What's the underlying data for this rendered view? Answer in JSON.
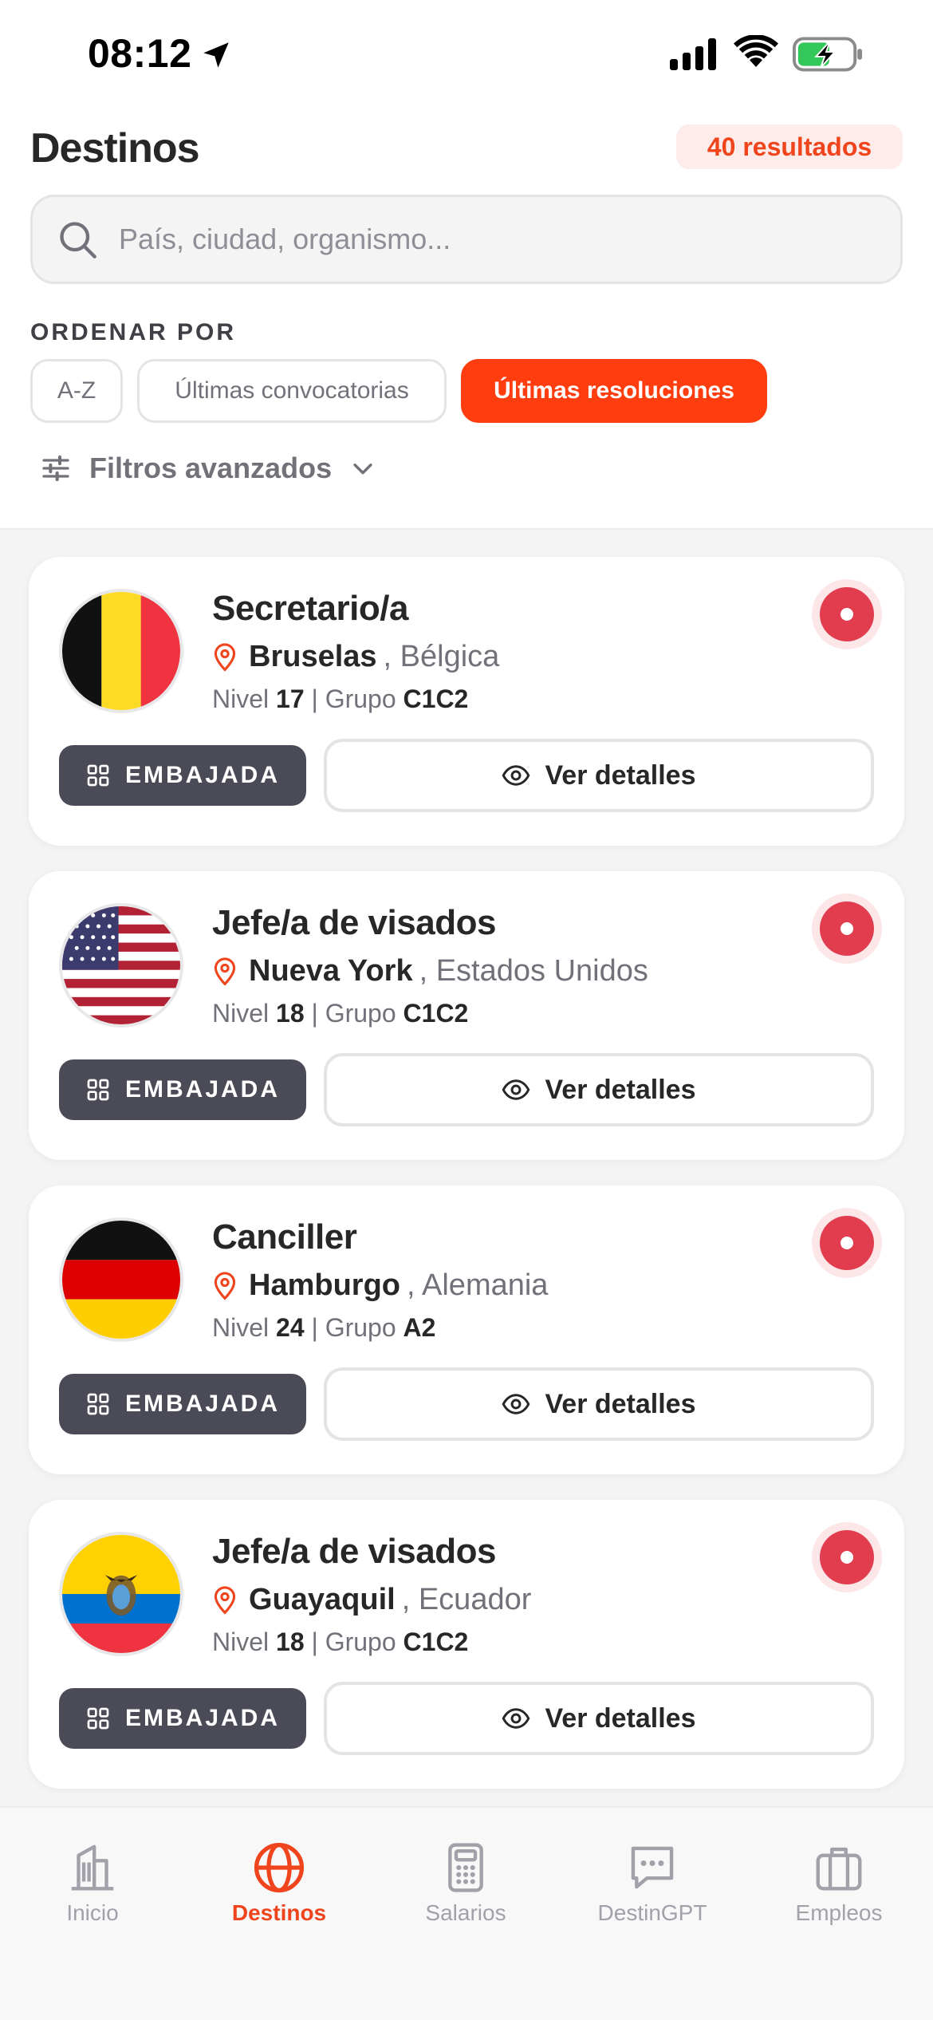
{
  "status_bar": {
    "time": "08:12"
  },
  "header": {
    "title": "Destinos",
    "results_badge": "40 resultados"
  },
  "search": {
    "placeholder": "País, ciudad, organismo..."
  },
  "sort": {
    "label": "ORDENAR POR",
    "options": [
      "A-Z",
      "Últimas convocatorias",
      "Últimas resoluciones"
    ],
    "selected": "Últimas resoluciones"
  },
  "filters": {
    "label": "Filtros avanzados"
  },
  "cards": [
    {
      "job": "Secretario/a",
      "city": "Bruselas",
      "country": ", Bélgica",
      "nivel_label": "Nivel",
      "nivel": "17",
      "sep": " | ",
      "grupo_label": "Grupo",
      "grupo": "C1C2",
      "tag": "EMBAJADA",
      "details": "Ver detalles",
      "flag": "belgium-flag"
    },
    {
      "job": "Jefe/a de visados",
      "city": "Nueva York",
      "country": ", Estados Unidos",
      "nivel_label": "Nivel",
      "nivel": "18",
      "sep": " | ",
      "grupo_label": "Grupo",
      "grupo": "C1C2",
      "tag": "EMBAJADA",
      "details": "Ver detalles",
      "flag": "usa-flag"
    },
    {
      "job": "Canciller",
      "city": "Hamburgo",
      "country": ", Alemania",
      "nivel_label": "Nivel",
      "nivel": "24",
      "sep": " | ",
      "grupo_label": "Grupo",
      "grupo": "A2",
      "tag": "EMBAJADA",
      "details": "Ver detalles",
      "flag": "germany-flag"
    },
    {
      "job": "Jefe/a de visados",
      "city": "Guayaquil",
      "country": ", Ecuador",
      "nivel_label": "Nivel",
      "nivel": "18",
      "sep": " | ",
      "grupo_label": "Grupo",
      "grupo": "C1C2",
      "tag": "EMBAJADA",
      "details": "Ver detalles",
      "flag": "ecuador-flag"
    }
  ],
  "tabbar": {
    "items": [
      "Inicio",
      "Destinos",
      "Salarios",
      "DestinGPT",
      "Empleos"
    ],
    "active": "Destinos"
  },
  "colors": {
    "accent": "#ff3d0f",
    "badge_bg": "#fdecea",
    "tag_bg": "#4a4b57",
    "status_dot": "#e23c4f"
  }
}
